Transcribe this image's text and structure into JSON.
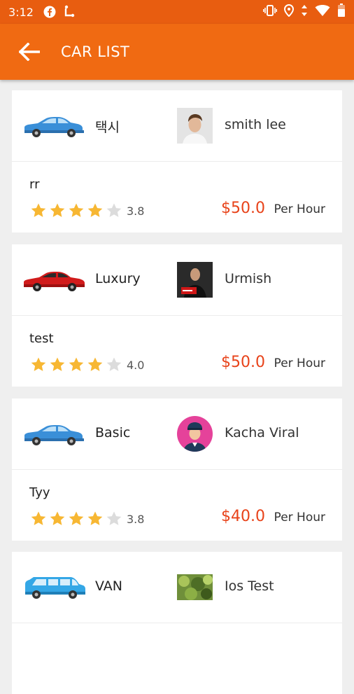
{
  "status": {
    "time": "3:12",
    "icons": [
      "facebook-icon",
      "walking-icon",
      "vibrate-icon",
      "location-icon",
      "data-arrows-icon",
      "wifi-icon",
      "battery-icon"
    ]
  },
  "header": {
    "title": "CAR LIST",
    "back_icon": "arrow-left-icon"
  },
  "colors": {
    "primary": "#f06a12",
    "status": "#e85d10",
    "price": "#e8431a",
    "star": "#f7b733",
    "star_empty": "#dcdcdc"
  },
  "cars": [
    {
      "type": "택시",
      "driver": "smith lee",
      "name": "rr",
      "rating": "3.8",
      "price": "$50.0",
      "unit": "Per Hour",
      "stars_filled": 4,
      "car_color": "#3a8fd8"
    },
    {
      "type": "Luxury",
      "driver": "Urmish",
      "name": "test",
      "rating": "4.0",
      "price": "$50.0",
      "unit": "Per Hour",
      "stars_filled": 4,
      "car_color": "#d11b1b"
    },
    {
      "type": "Basic",
      "driver": "Kacha Viral",
      "name": "Tyy",
      "rating": "3.8",
      "price": "$40.0",
      "unit": "Per Hour",
      "stars_filled": 4,
      "car_color": "#3a8fd8"
    },
    {
      "type": "VAN",
      "driver": "Ios Test",
      "name": "",
      "rating": "",
      "price": "",
      "unit": "",
      "stars_filled": 0,
      "car_color": "#34a7e6"
    }
  ]
}
